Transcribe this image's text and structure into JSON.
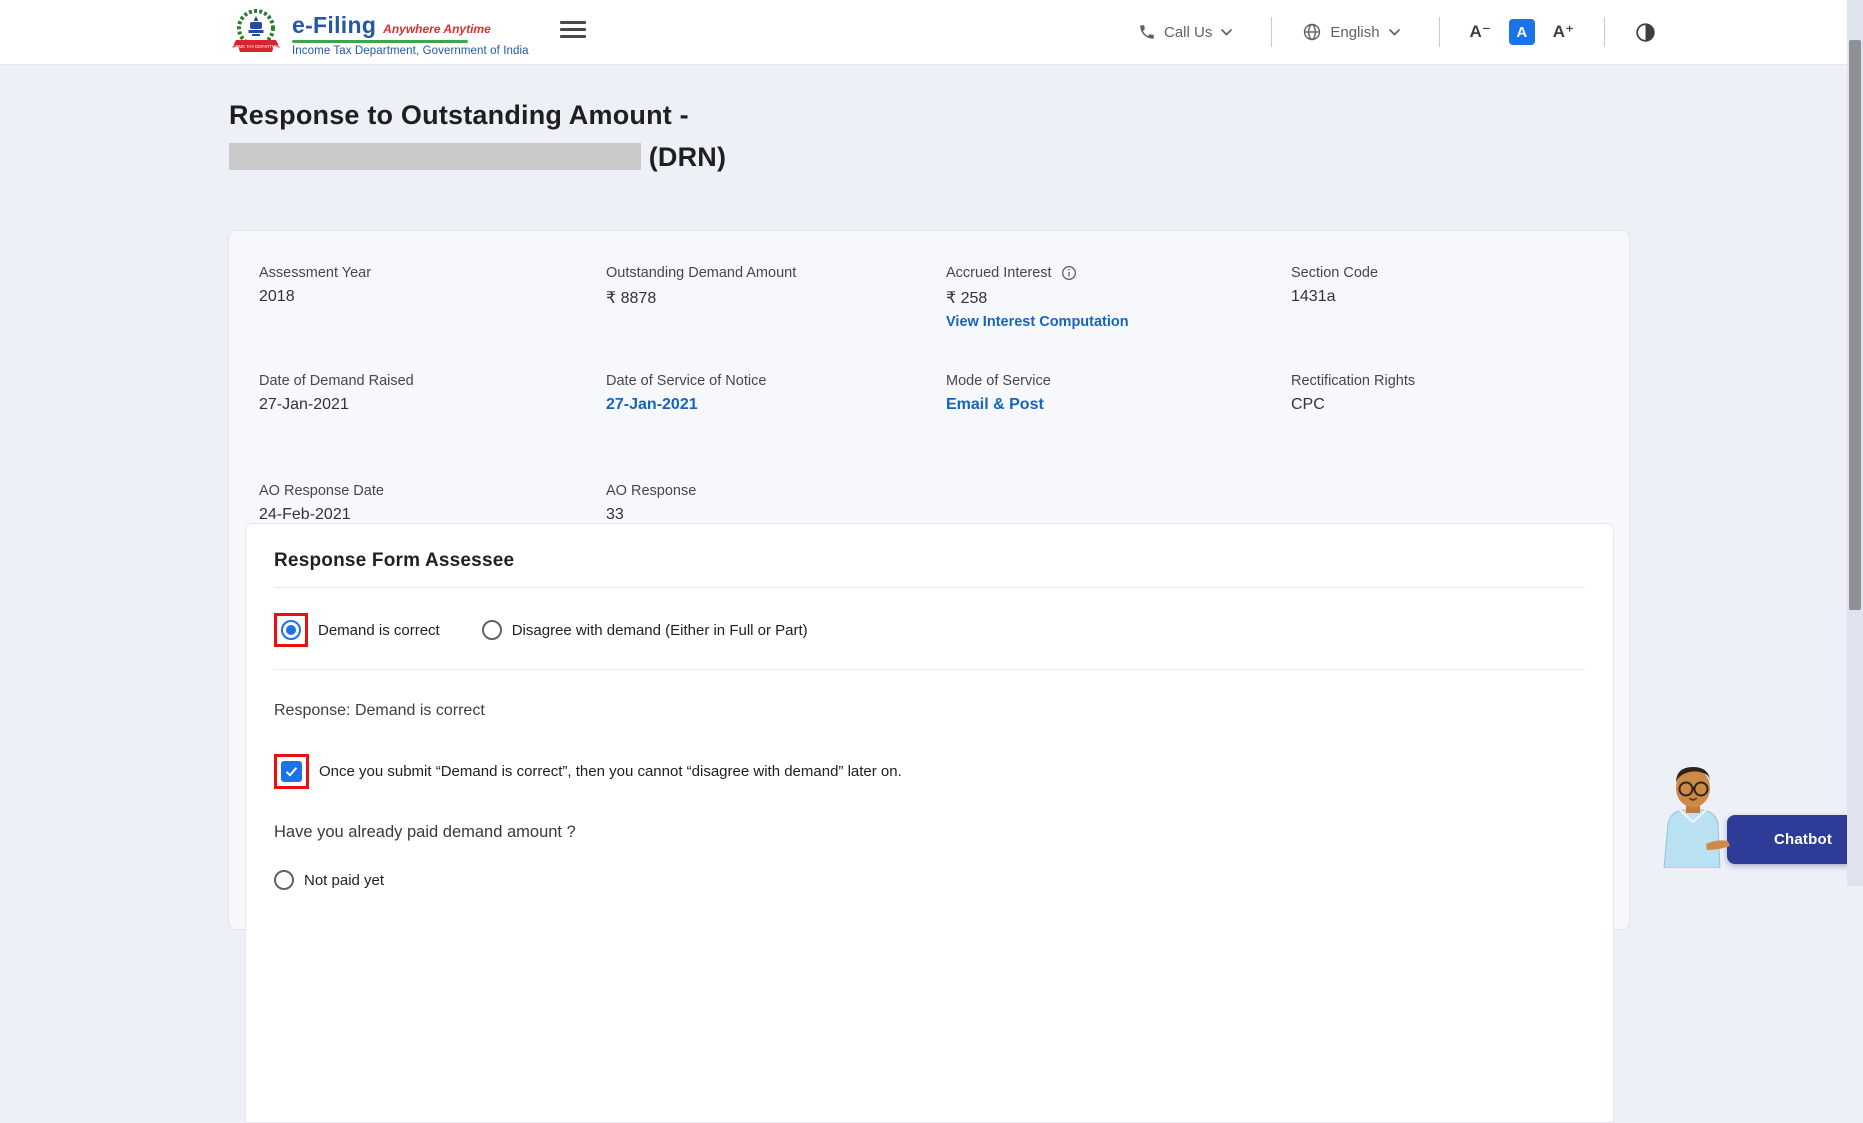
{
  "header": {
    "brand": "e-Filing",
    "tagline": "Anywhere Anytime",
    "dept": "Income Tax Department, Government of India",
    "call_us": "Call Us",
    "language": "English",
    "font_decrease": "A⁻",
    "font_default": "A",
    "font_increase": "A⁺"
  },
  "page": {
    "title_line1": "Response to Outstanding Amount -",
    "title_line2_suffix": "(DRN)"
  },
  "summary": {
    "rows": [
      [
        {
          "label": "Assessment Year",
          "value": "2018"
        },
        {
          "label": "Outstanding Demand Amount",
          "value": "₹ 8878"
        },
        {
          "label": "Accrued Interest",
          "value": "₹ 258",
          "link": "View Interest Computation"
        },
        {
          "label": "Section Code",
          "value": "1431a"
        }
      ],
      [
        {
          "label": "Date of Demand Raised",
          "value": "27-Jan-2021"
        },
        {
          "label": "Date of Service of Notice",
          "value": "27-Jan-2021"
        },
        {
          "label": "Mode of Service",
          "value": "Email & Post"
        },
        {
          "label": "Rectification Rights",
          "value": "CPC"
        }
      ],
      [
        {
          "label": "AO Response Date",
          "value": "24-Feb-2021"
        },
        {
          "label": "AO Response",
          "value": "33"
        }
      ]
    ]
  },
  "form": {
    "heading": "Response Form Assessee",
    "option_correct": "Demand is correct",
    "option_disagree": "Disagree with demand (Either in Full or Part)",
    "response_text": "Response: Demand is correct",
    "confirm_text": "Once you submit “Demand is correct”, then you cannot “disagree with demand” later on.",
    "question": "Have you already paid demand amount ?",
    "option_not_paid": "Not paid yet"
  },
  "chatbot": {
    "label": "Chatbot"
  },
  "colors": {
    "accent_blue": "#1a73e8",
    "link_blue": "#1565c0",
    "annotation_red": "#ea1010",
    "chatbot_indigo": "#2e3b97",
    "logo_green": "#3fa44a",
    "logo_red": "#d93030",
    "card_bg": "#f7f8fc",
    "page_bg": "#eef0f7"
  }
}
